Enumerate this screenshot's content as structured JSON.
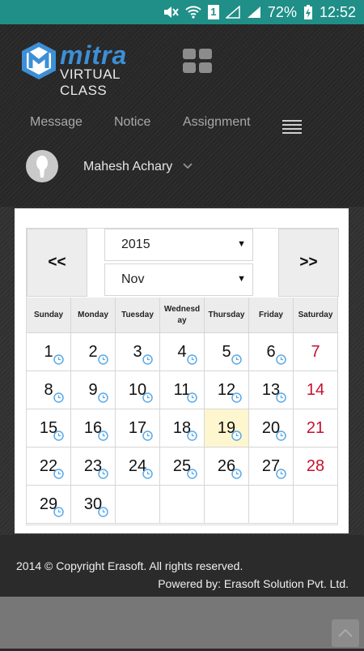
{
  "status_bar": {
    "battery": "72%",
    "time": "12:52",
    "sim": "1"
  },
  "app": {
    "logo_name": "mitra",
    "logo_sub": "VIRTUAL CLASS"
  },
  "nav": {
    "items": [
      "Message",
      "Notice",
      "Assignment"
    ]
  },
  "user": {
    "name": "Mahesh Achary"
  },
  "calendar": {
    "prev_label": "<<",
    "next_label": ">>",
    "year": "2015",
    "month": "Nov",
    "weekdays": [
      "Sunday",
      "Monday",
      "Tuesday",
      "Wednesday",
      "Thursday",
      "Friday",
      "Saturday"
    ],
    "weekday_display": [
      "Sunday",
      "Monday",
      "Tuesday",
      "Wednesd\nay",
      "Thursday",
      "Friday",
      "Saturday"
    ],
    "weeks": [
      [
        "1",
        "2",
        "3",
        "4",
        "5",
        "6",
        "7"
      ],
      [
        "8",
        "9",
        "10",
        "11",
        "12",
        "13",
        "14"
      ],
      [
        "15",
        "16",
        "17",
        "18",
        "19",
        "20",
        "21"
      ],
      [
        "22",
        "23",
        "24",
        "25",
        "26",
        "27",
        "28"
      ],
      [
        "29",
        "30",
        "",
        "",
        "",
        "",
        ""
      ]
    ],
    "today": "19",
    "colors": {
      "weekend": "#c8102e",
      "today_bg": "#fef6cf",
      "clock": "#5aa9e6"
    }
  },
  "footer": {
    "copyright": "2014 © Copyright Erasoft. All rights reserved.",
    "powered": "Powered by: Erasoft Solution Pvt. Ltd."
  }
}
